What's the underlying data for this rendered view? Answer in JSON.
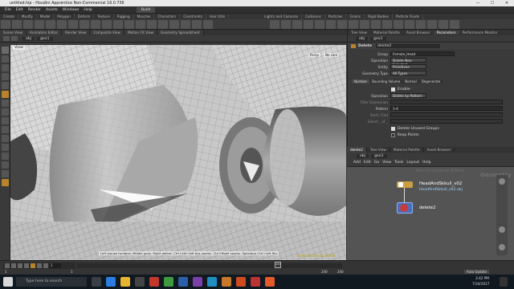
{
  "window": {
    "title": "untitled.hip - Houdini Apprentice Non-Commercial 16.0.736",
    "min": "—",
    "max": "☐",
    "close": "✕"
  },
  "menu": [
    "File",
    "Edit",
    "Render",
    "Assets",
    "Windows",
    "Help"
  ],
  "desktop": "Build",
  "shelf_tabs": [
    "Create",
    "Modify",
    "Model",
    "Polygon",
    "Deform",
    "Texture",
    "Rigging",
    "Muscles",
    "Characters",
    "Constraints",
    "Hair Utils",
    "Guide Process",
    "Guide Brushes",
    "Terrain FX",
    "Cloud FX",
    "Volume",
    "Lights and Cameras",
    "Collisions",
    "Particles",
    "Grains",
    "Rigid Bodies",
    "Particle Fluids",
    "Viscous Fluids",
    "Oceans",
    "Fluid Containers",
    "Populate Containers",
    "Container Tools",
    "Pyro FX",
    "FEM",
    "Wires",
    "Crowds",
    "Drive Simulation"
  ],
  "pane_tabs": [
    "Scene View",
    "Animation Editor",
    "Render View",
    "Composite View",
    "Motion FX View",
    "Geometry Spreadsheet"
  ],
  "right_tabs": [
    "Tree View",
    "Material Palette",
    "Asset Browser",
    "Parameters",
    "Performance Monitor"
  ],
  "path": "obj",
  "node_path": "geo1",
  "viewport": {
    "label": "View",
    "persp": "Persp",
    "cam": "No cam",
    "status": "Left mouse tumbles. Middle pans. Right dollies. Ctrl+Alt+Left box zooms. Ctrl+Right zooms. Spacebar Ctrl+Left fills",
    "badge": "Non-Commercial Edition"
  },
  "params": {
    "node_type": "Delete",
    "node_name": "delete2",
    "group_label": "Group",
    "group_value": "Female_Head",
    "operation_label": "Operation",
    "operation_value": "Delete Non-Selected",
    "entity_label": "Entity",
    "entity_value": "Primitives",
    "geotype_label": "Geometry Type",
    "geotype_value": "All Types",
    "subtabs": [
      "Number",
      "Bounding Volume",
      "Normal",
      "Degenerate"
    ],
    "enable": "Enable",
    "op2_label": "Operation",
    "op2_value": "Delete by Pattern",
    "filter_label": "Filter Expression",
    "pattern_label": "Pattern",
    "pattern_value": "1-4",
    "start_label": "Start / End",
    "select_label": "Select _ of _",
    "delete_unused": "Delete Unused Groups",
    "keep_points": "Keep Points"
  },
  "network": {
    "tabs": [
      "delete2",
      "Tree View",
      "Material Palette",
      "Asset Browser"
    ],
    "menu": [
      "Add",
      "Edit",
      "Go",
      "View",
      "Tools",
      "Layout",
      "Help"
    ],
    "path": "obj",
    "geo": "geo1",
    "watermark1": "Non-Commercial Edition",
    "watermark2": "Geometry",
    "node1": "HeadAndSkkull_v02",
    "node1_file": "HeadAndSkkull_v02.obj",
    "node2": "delete2"
  },
  "timeline": {
    "frame": "1",
    "start": "1",
    "end": "240",
    "current": "240",
    "marker": "240"
  },
  "taskbar": {
    "search": "Type here to search",
    "time": "3:42 PM",
    "date": "7/24/2017",
    "auto_update": "Auto Update"
  }
}
